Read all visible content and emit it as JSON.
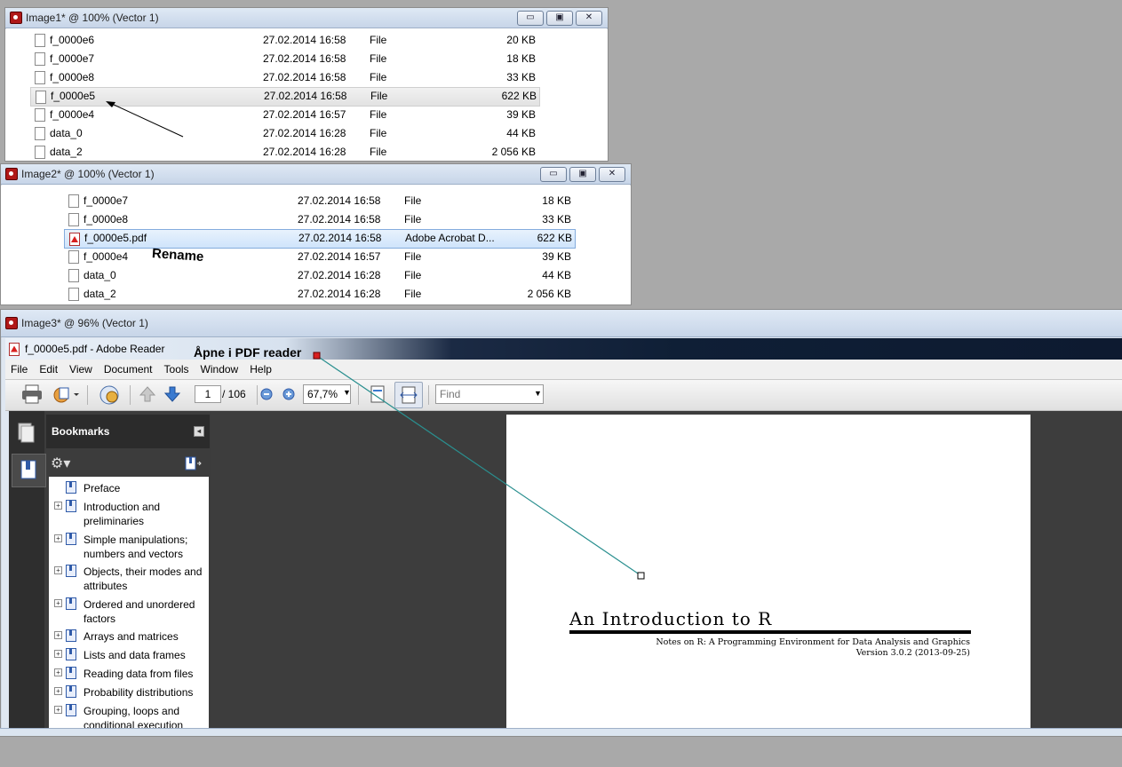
{
  "window1": {
    "title": "Image1* @ 100% (Vector 1)",
    "controls": [
      "▭",
      "▣",
      "✕"
    ],
    "rows": [
      {
        "name": "f_0000e6",
        "date": "27.02.2014 16:58",
        "type": "File",
        "size": "20 KB"
      },
      {
        "name": "f_0000e7",
        "date": "27.02.2014 16:58",
        "type": "File",
        "size": "18 KB"
      },
      {
        "name": "f_0000e8",
        "date": "27.02.2014 16:58",
        "type": "File",
        "size": "33 KB"
      },
      {
        "name": "f_0000e5",
        "date": "27.02.2014 16:58",
        "type": "File",
        "size": "622 KB",
        "selected": true
      },
      {
        "name": "f_0000e4",
        "date": "27.02.2014 16:57",
        "type": "File",
        "size": "39 KB"
      },
      {
        "name": "data_0",
        "date": "27.02.2014 16:28",
        "type": "File",
        "size": "44 KB"
      },
      {
        "name": "data_2",
        "date": "27.02.2014 16:28",
        "type": "File",
        "size": "2 056 KB"
      }
    ]
  },
  "window2": {
    "title": "Image2* @ 100% (Vector 1)",
    "controls": [
      "▭",
      "▣",
      "✕"
    ],
    "rows": [
      {
        "name": "f_0000e7",
        "date": "27.02.2014 16:58",
        "type": "File",
        "size": "18 KB"
      },
      {
        "name": "f_0000e8",
        "date": "27.02.2014 16:58",
        "type": "File",
        "size": "33 KB"
      },
      {
        "name": "f_0000e5.pdf",
        "date": "27.02.2014 16:58",
        "type": "Adobe Acrobat D...",
        "size": "622 KB",
        "selected": true,
        "pdf": true
      },
      {
        "name": "f_0000e4",
        "date": "27.02.2014 16:57",
        "type": "File",
        "size": "39 KB"
      },
      {
        "name": "data_0",
        "date": "27.02.2014 16:28",
        "type": "File",
        "size": "44 KB"
      },
      {
        "name": "data_2",
        "date": "27.02.2014 16:28",
        "type": "File",
        "size": "2 056 KB"
      }
    ],
    "annotation": "Rename"
  },
  "window3": {
    "title": "Image3* @ 96% (Vector 1)",
    "annotation": "Åpne i PDF reader",
    "reader": {
      "title": "f_0000e5.pdf - Adobe Reader",
      "menu": [
        "File",
        "Edit",
        "View",
        "Document",
        "Tools",
        "Window",
        "Help"
      ],
      "page_current": "1",
      "page_total": "/ 106",
      "zoom": "67,7%",
      "find_placeholder": "Find",
      "bookmarks_label": "Bookmarks",
      "bookmarks": [
        {
          "label": "Preface",
          "expandable": false
        },
        {
          "label": "Introduction and preliminaries",
          "expandable": true
        },
        {
          "label": "Simple manipulations; numbers and vectors",
          "expandable": true
        },
        {
          "label": "Objects, their modes and attributes",
          "expandable": true
        },
        {
          "label": "Ordered and unordered factors",
          "expandable": true
        },
        {
          "label": "Arrays and matrices",
          "expandable": true
        },
        {
          "label": "Lists and data frames",
          "expandable": true
        },
        {
          "label": "Reading data from files",
          "expandable": true
        },
        {
          "label": "Probability distributions",
          "expandable": true
        },
        {
          "label": "Grouping, loops and conditional execution",
          "expandable": true
        }
      ],
      "doc": {
        "title": "An Introduction to R",
        "subtitle": "Notes on R: A Programming Environment for Data Analysis and Graphics",
        "version": "Version 3.0.2 (2013-09-25)"
      }
    }
  },
  "colors": {
    "pdf_red": "#d82020",
    "selection_blue": "#cfe4fb",
    "annotation_line": "#2a8f8f"
  }
}
